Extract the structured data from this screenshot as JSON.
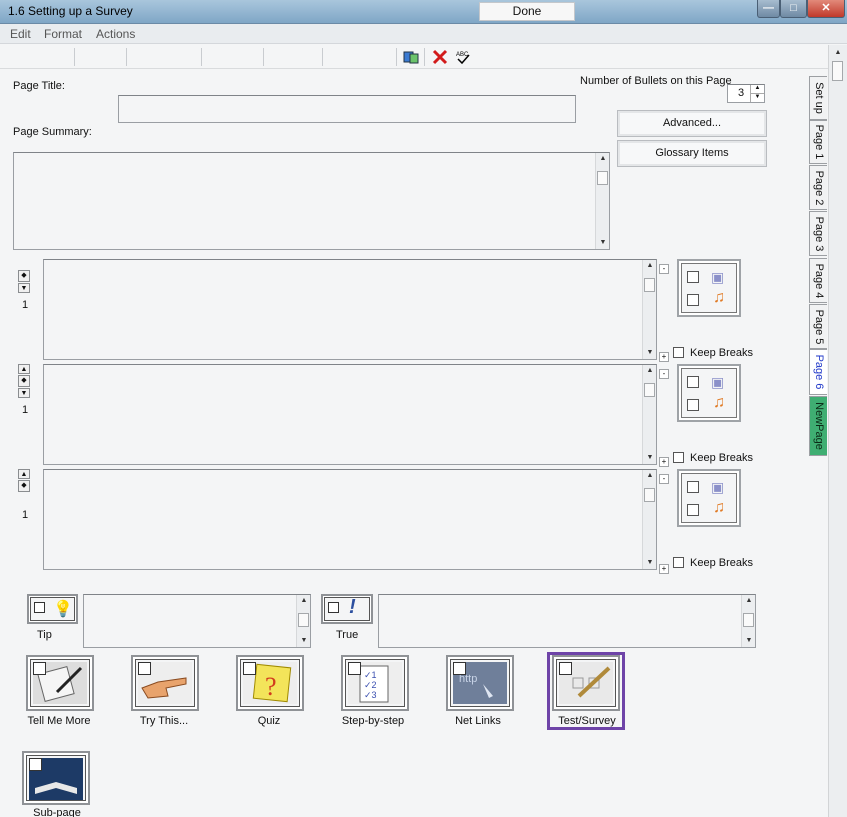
{
  "window": {
    "title": "1.6 Setting up a Survey",
    "min": "—",
    "max": "□",
    "close": "✕"
  },
  "menu": {
    "items": [
      "Edit",
      "Format",
      "Actions"
    ]
  },
  "toolbar": {
    "done_label": "Done",
    "icons": [
      "book-icon",
      "delete-x-icon",
      "spellcheck-icon"
    ]
  },
  "form": {
    "page_title_label": "Page Title:",
    "page_title_value": "",
    "page_summary_label": "Page Summary:",
    "page_summary_value": "",
    "bullets_label": "Number of Bullets on this Page",
    "bullets_value": "3",
    "advanced_label": "Advanced...",
    "glossary_label": "Glossary Items"
  },
  "bullets": [
    {
      "number": "1",
      "keep_breaks_label": "Keep Breaks"
    },
    {
      "number": "1",
      "keep_breaks_label": "Keep Breaks"
    },
    {
      "number": "1",
      "keep_breaks_label": "Keep Breaks"
    }
  ],
  "tabs": [
    {
      "label": "Set up",
      "active": false
    },
    {
      "label": "Page 1",
      "active": false
    },
    {
      "label": "Page 2",
      "active": false
    },
    {
      "label": "Page 3",
      "active": false
    },
    {
      "label": "Page 4",
      "active": false
    },
    {
      "label": "Page 5",
      "active": false
    },
    {
      "label": "Page 6",
      "active": true
    },
    {
      "label": "NewPage",
      "active": false
    }
  ],
  "notes": [
    {
      "label": "Tip",
      "icon": "lightbulb-icon"
    },
    {
      "label": "True",
      "icon": "exclamation-icon"
    }
  ],
  "tiles": [
    {
      "label": "Tell Me More",
      "icon": "notebook-pen-icon"
    },
    {
      "label": "Try This...",
      "icon": "pointing-hand-icon"
    },
    {
      "label": "Quiz",
      "icon": "question-note-icon"
    },
    {
      "label": "Step-by-step",
      "icon": "checklist-icon"
    },
    {
      "label": "Net Links",
      "icon": "http-link-icon"
    },
    {
      "label": "Test/Survey",
      "icon": "survey-pen-icon",
      "selected": true
    },
    {
      "label": "Sub-page",
      "icon": "open-book-icon"
    }
  ],
  "colors": {
    "accent_selected": "#6e44a8",
    "tab_newpage": "#3fae72",
    "tab_active_text": "#1f37c9"
  }
}
